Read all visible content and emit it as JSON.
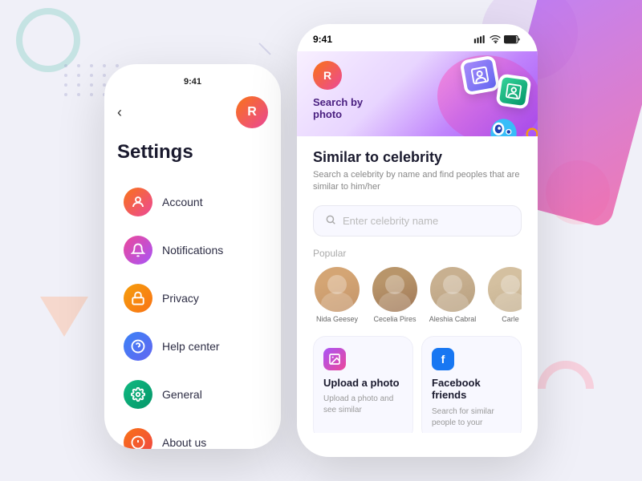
{
  "background": {
    "color": "#f0f0f8"
  },
  "phones": {
    "left": {
      "status_time": "9:41",
      "title": "Settings",
      "avatar_letter": "R",
      "back_arrow": "‹",
      "menu_items": [
        {
          "id": "account",
          "label": "Account",
          "emoji": "👤"
        },
        {
          "id": "notifications",
          "label": "Notifications",
          "emoji": "🔔"
        },
        {
          "id": "privacy",
          "label": "Privacy",
          "emoji": "🔒"
        },
        {
          "id": "help",
          "label": "Help center",
          "emoji": "❓"
        },
        {
          "id": "general",
          "label": "General",
          "emoji": "⚙️"
        },
        {
          "id": "about",
          "label": "About us",
          "emoji": "ℹ️"
        }
      ]
    },
    "right": {
      "status_time": "9:41",
      "signal": "▲▲▲",
      "wifi": "WiFi",
      "battery": "Battery",
      "hero": {
        "avatar_letter": "R",
        "label": "Search by",
        "sublabel": "photo"
      },
      "section": {
        "title": "Similar to celebrity",
        "desc": "Search a celebrity by name and find peoples that are similar to him/her"
      },
      "search": {
        "placeholder": "Enter celebrity name"
      },
      "popular_label": "Popular",
      "people": [
        {
          "name": "Nida Geesey"
        },
        {
          "name": "Cecelia Pires"
        },
        {
          "name": "Aleshia Cabral"
        },
        {
          "name": "Carle"
        }
      ],
      "cards": [
        {
          "id": "upload",
          "title": "Upload a photo",
          "desc": "Upload a photo and see similar",
          "icon": "📷"
        },
        {
          "id": "facebook",
          "title": "Facebook friends",
          "desc": "Search for similar people to your",
          "icon": "f"
        }
      ]
    }
  }
}
